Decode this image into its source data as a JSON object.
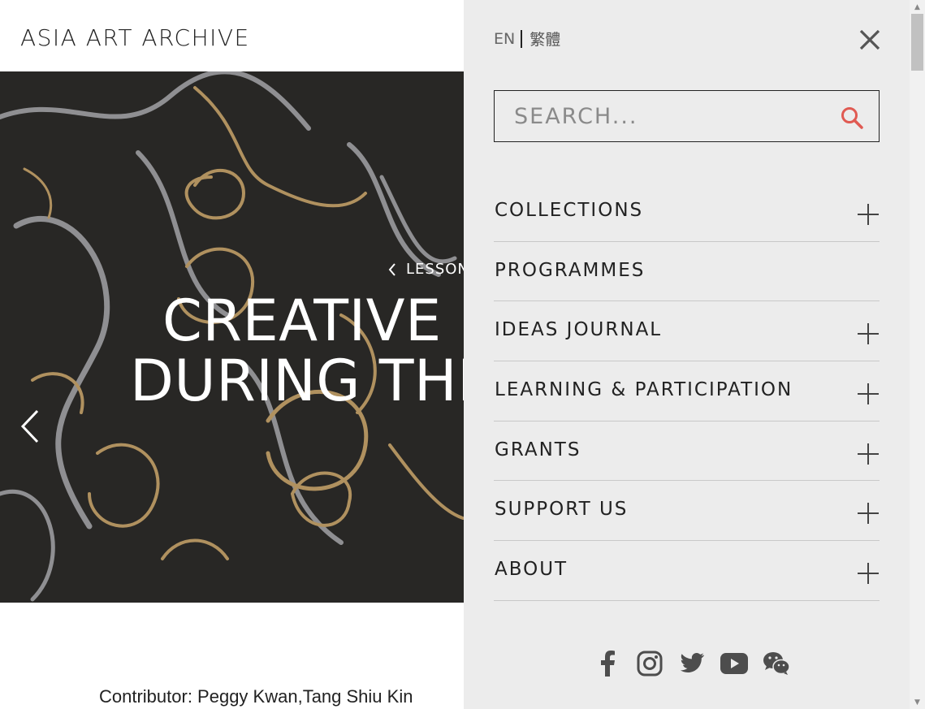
{
  "header": {
    "logo": "ASIA ART ARCHIVE"
  },
  "hero": {
    "breadcrumb": "LESSON",
    "title_line1": "CREATIVE E",
    "title_line2": "DURING THE"
  },
  "article": {
    "contributor": "Contributor: Peggy Kwan,Tang Shiu Kin"
  },
  "menu": {
    "languages": [
      "EN",
      "繁體"
    ],
    "search_placeholder": "SEARCH...",
    "accent_color": "#e05a52",
    "items": [
      {
        "label": "COLLECTIONS",
        "expandable": true
      },
      {
        "label": "PROGRAMMES",
        "expandable": false
      },
      {
        "label": "IDEAS JOURNAL",
        "expandable": true
      },
      {
        "label": "LEARNING & PARTICIPATION",
        "expandable": true
      },
      {
        "label": "GRANTS",
        "expandable": true
      },
      {
        "label": "SUPPORT US",
        "expandable": true
      },
      {
        "label": "ABOUT",
        "expandable": true
      }
    ],
    "social": [
      "facebook-icon",
      "instagram-icon",
      "twitter-icon",
      "youtube-icon",
      "wechat-icon"
    ]
  }
}
